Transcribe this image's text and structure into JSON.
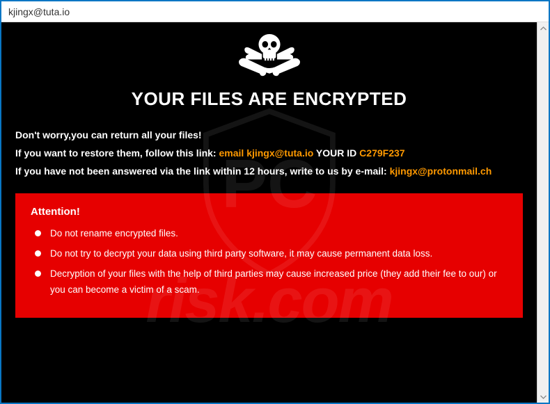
{
  "titlebar": {
    "title": "kjingx@tuta.io"
  },
  "headline": "YOUR FILES ARE ENCRYPTED",
  "intro": {
    "line1_plain": "Don't worry,",
    "line1_bold": "you can return",
    "line1_rest": " all your files!",
    "line2_pre": "If you",
    "line2_bold": " want to restore them, follow this link: ",
    "line2_email_label": "email ",
    "line2_email": "kjingx@tuta.io",
    "line2_id_label": "  YOUR ID ",
    "line2_id": "C279F237",
    "line3_pre": "If you",
    "line3_bold": " have not been answered ",
    "line3_mid": "via the link within 12 hours, write to us by e-mail: ",
    "line3_email": "kjingx@protonmail.ch"
  },
  "attention": {
    "title": "Attention!",
    "items": [
      "Do not rename encrypted files.",
      "Do not try to decrypt your data using third party software, it may cause permanent data loss.",
      "Decryption of your files with the help of third parties may cause increased price (they add their fee to our) or you can become a victim of a scam."
    ]
  },
  "watermark": {
    "text": "risk.com"
  }
}
